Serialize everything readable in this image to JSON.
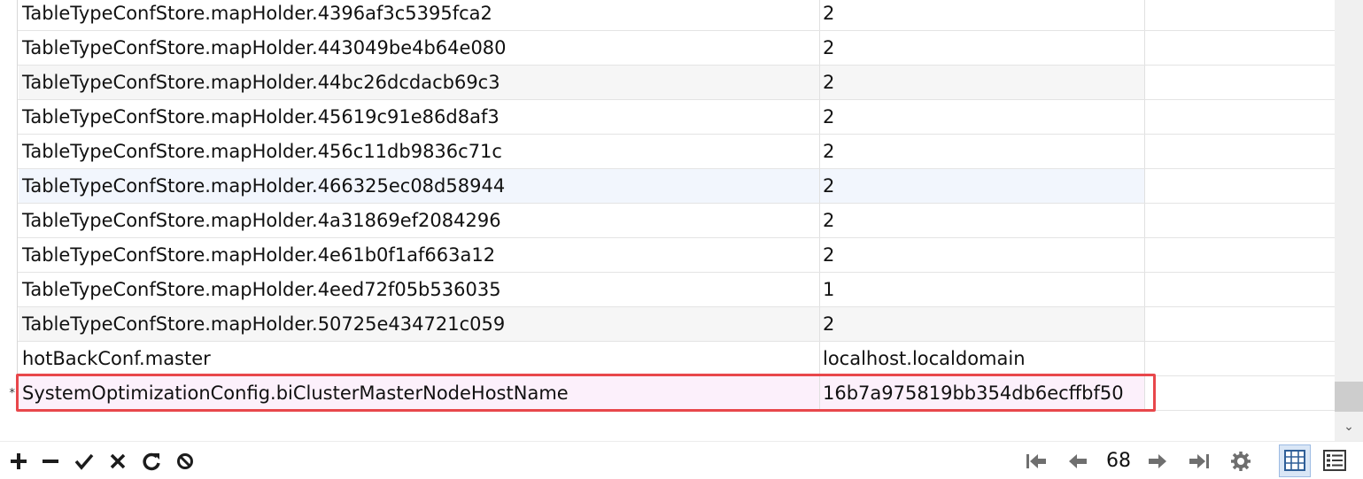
{
  "rows": [
    {
      "key": "TableTypeConfStore.mapHolder.4396af3c5395fca2",
      "value": "2"
    },
    {
      "key": "TableTypeConfStore.mapHolder.443049be4b64e080",
      "value": "2"
    },
    {
      "key": "TableTypeConfStore.mapHolder.44bc26dcdacb69c3",
      "value": "2"
    },
    {
      "key": "TableTypeConfStore.mapHolder.45619c91e86d8af3",
      "value": "2"
    },
    {
      "key": "TableTypeConfStore.mapHolder.456c11db9836c71c",
      "value": "2"
    },
    {
      "key": "TableTypeConfStore.mapHolder.466325ec08d58944",
      "value": "2"
    },
    {
      "key": "TableTypeConfStore.mapHolder.4a31869ef2084296",
      "value": "2"
    },
    {
      "key": "TableTypeConfStore.mapHolder.4e61b0f1af663a12",
      "value": "2"
    },
    {
      "key": "TableTypeConfStore.mapHolder.4eed72f05b536035",
      "value": "1"
    },
    {
      "key": "TableTypeConfStore.mapHolder.50725e434721c059",
      "value": "2"
    },
    {
      "key": "hotBackConf.master",
      "value": "localhost.localdomain"
    },
    {
      "key": "SystemOptimizationConfig.biClusterMasterNodeHostName",
      "value": "16b7a975819bb354db6ecffbf50"
    }
  ],
  "new_row_marker": "*",
  "toolbar": {
    "add_icon": "plus-icon",
    "remove_icon": "minus-icon",
    "apply_icon": "check-icon",
    "discard_icon": "x-icon",
    "refresh_icon": "refresh-icon",
    "stop_icon": "stop-icon",
    "first_icon": "first-page-icon",
    "prev_icon": "prev-page-icon",
    "page": "68",
    "next_icon": "next-page-icon",
    "last_icon": "last-page-icon",
    "settings_icon": "gear-icon",
    "grid_view_icon": "grid-view-icon",
    "form_view_icon": "form-view-icon"
  },
  "colors": {
    "selection_outline": "#e8474b",
    "selected_row": "#fcf0fb",
    "grid_view_active": "#d9e6f6"
  }
}
